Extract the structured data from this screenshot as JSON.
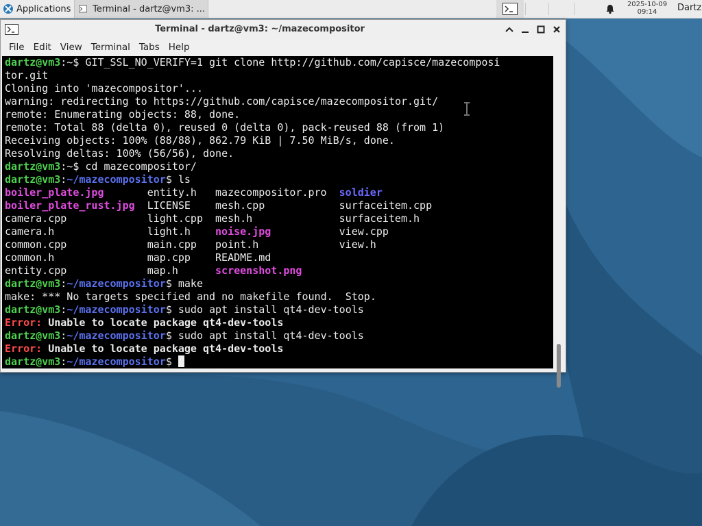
{
  "panel": {
    "applications_label": "Applications",
    "taskbar_label": "Terminal - dartz@vm3: ...",
    "clock_date": "2025-10-09",
    "clock_time": "09:14",
    "user_label": "Dartz"
  },
  "window": {
    "title": "Terminal - dartz@vm3: ~/mazecompositor",
    "menu": [
      "File",
      "Edit",
      "View",
      "Terminal",
      "Tabs",
      "Help"
    ]
  },
  "terminal": {
    "prompt_user": "dartz@vm3",
    "lines": [
      "GIT_SSL_NO_VERIFY=1 git clone http://github.com/capisce/mazecomposi",
      "tor.git",
      "Cloning into 'mazecompositor'...",
      "warning: redirecting to https://github.com/capisce/mazecompositor.git/",
      "remote: Enumerating objects: 88, done.",
      "remote: Total 88 (delta 0), reused 0 (delta 0), pack-reused 88 (from 1)",
      "Receiving objects: 100% (88/88), 862.79 KiB | 7.50 MiB/s, done.",
      "Resolving deltas: 100% (56/56), done.",
      "cd mazecompositor/",
      "~/mazecompositor",
      "ls",
      "make",
      "make: *** No targets specified and no makefile found.  Stop.",
      "sudo apt install qt4-dev-tools",
      "Error:",
      "Unable to locate package qt4-dev-tools"
    ],
    "ls_columns": [
      [
        "boiler_plate.jpg",
        "boiler_plate_rust.jpg",
        "camera.cpp",
        "camera.h",
        "common.cpp",
        "common.h",
        "entity.cpp"
      ],
      [
        "entity.h",
        "LICENSE",
        "light.cpp",
        "light.h",
        "main.cpp",
        "map.cpp",
        "map.h"
      ],
      [
        "mazecompositor.pro",
        "mesh.cpp",
        "mesh.h",
        "noise.jpg",
        "point.h",
        "README.md",
        "screenshot.png"
      ],
      [
        "soldier",
        "surfaceitem.cpp",
        "surfaceitem.h",
        "view.cpp",
        "view.h"
      ]
    ]
  },
  "colors": {
    "prompt_user": "#4fd14f",
    "prompt_path": "#5b72f0",
    "image_file": "#e04ce0",
    "directory": "#6a6aff",
    "error": "#ff4b4b"
  }
}
